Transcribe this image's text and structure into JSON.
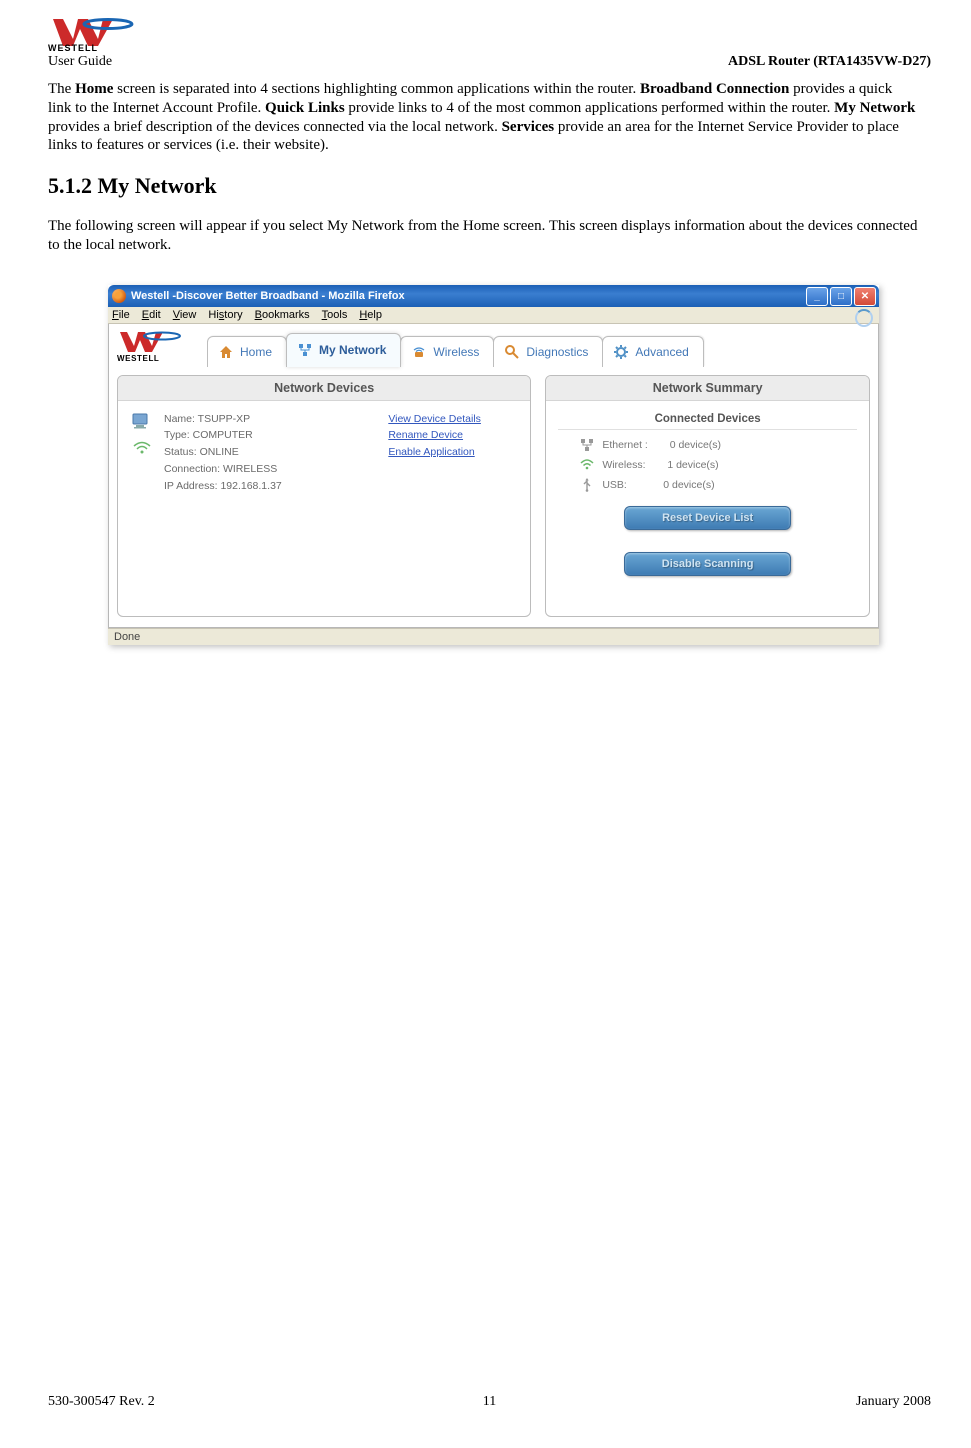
{
  "header": {
    "user_guide": "User Guide",
    "model": "ADSL Router (RTA1435VW-D27)"
  },
  "para_html": "The <b>Home</b> screen is separated into 4 sections highlighting common applications within the router.  <b>Broadband Connection</b> provides a quick link to the Internet Account Profile.  <b>Quick Links</b> provide links to 4 of the most common applications performed within the router.  <b>My Network</b> provides a brief description of the devices connected via the local network. <b>Services</b> provide an area for the Internet Service Provider to place links to features or services (i.e. their website).",
  "section_heading": "5.1.2 My Network",
  "para2": "The following screen will appear if you select My Network from the Home screen. This screen displays information about the devices connected to the local network.",
  "browser": {
    "title": "Westell -Discover Better Broadband - Mozilla Firefox",
    "menus": [
      "File",
      "Edit",
      "View",
      "History",
      "Bookmarks",
      "Tools",
      "Help"
    ],
    "status": "Done"
  },
  "tabs": {
    "home": "Home",
    "mynet": "My Network",
    "wireless": "Wireless",
    "diag": "Diagnostics",
    "adv": "Advanced"
  },
  "panels": {
    "devices_title": "Network Devices",
    "summary_title": "Network Summary",
    "connected_title": "Connected Devices"
  },
  "device": {
    "name_label": "Name:",
    "name_value": "TSUPP-XP",
    "type_label": "Type:",
    "type_value": "COMPUTER",
    "status_label": "Status:",
    "status_value": "ONLINE",
    "conn_label": "Connection:",
    "conn_value": "WIRELESS",
    "ip_label": "IP Address:",
    "ip_value": "192.168.1.37"
  },
  "device_links": {
    "view": "View Device Details",
    "rename": "Rename Device",
    "enable": "Enable Application"
  },
  "summary": {
    "eth_label": "Ethernet :",
    "eth_value": "0 device(s)",
    "wifi_label": "Wireless:",
    "wifi_value": "1 device(s)",
    "usb_label": "USB:",
    "usb_value": "0 device(s)"
  },
  "buttons": {
    "reset": "Reset Device List",
    "disable": "Disable Scanning"
  },
  "footer": {
    "left": "530-300547 Rev. 2",
    "center": "11",
    "right": "January 2008"
  }
}
